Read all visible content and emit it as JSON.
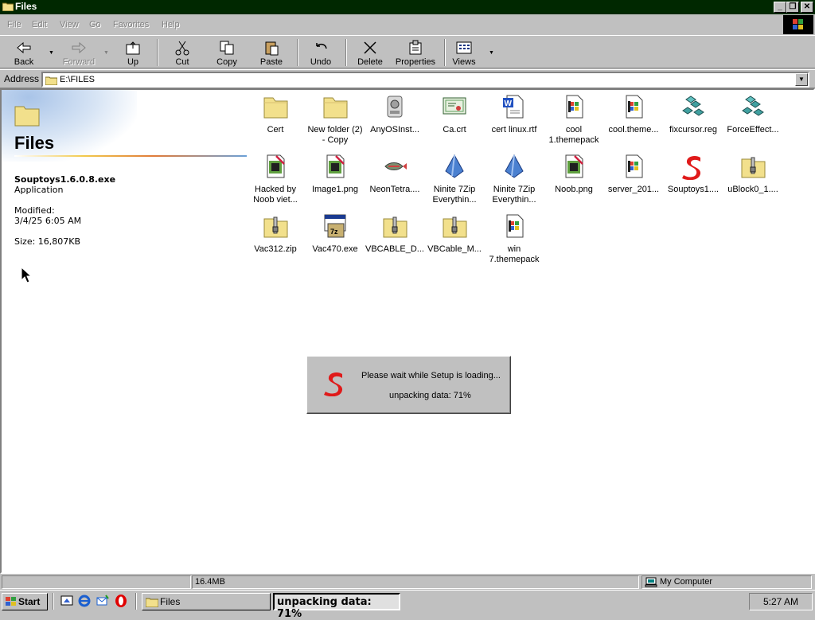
{
  "window": {
    "title": "Files",
    "buttons": [
      "minimize",
      "restore",
      "close"
    ]
  },
  "menu": [
    "File",
    "Edit",
    "View",
    "Go",
    "Favorites",
    "Help"
  ],
  "toolbar": {
    "back": "Back",
    "forward": "Forward",
    "up": "Up",
    "cut": "Cut",
    "copy": "Copy",
    "paste": "Paste",
    "undo": "Undo",
    "delete": "Delete",
    "properties": "Properties",
    "views": "Views"
  },
  "address": {
    "label": "Address",
    "value": "E:\\FILES"
  },
  "webview": {
    "folder_title": "Files",
    "file_name": "Souptoys1.6.0.8.exe",
    "file_type": "Application",
    "modified_label": "Modified:",
    "modified_value": "3/4/25 6:05 AM",
    "size": "Size: 16,807KB"
  },
  "files": [
    {
      "name": "Cert",
      "name2": "",
      "icon": "folder-icon"
    },
    {
      "name": "New folder (2)",
      "name2": "- Copy",
      "icon": "folder-icon"
    },
    {
      "name": "AnyOSInst...",
      "name2": "",
      "icon": "installer-icon"
    },
    {
      "name": "Ca.crt",
      "name2": "",
      "icon": "certificate-icon"
    },
    {
      "name": "cert linux.rtf",
      "name2": "",
      "icon": "word-document-icon"
    },
    {
      "name": "cool",
      "name2": "1.themepack",
      "icon": "themepack-icon"
    },
    {
      "name": "cool.theme...",
      "name2": "",
      "icon": "themepack-icon"
    },
    {
      "name": "fixcursor.reg",
      "name2": "",
      "icon": "registry-icon"
    },
    {
      "name": "ForceEffect...",
      "name2": "",
      "icon": "registry-icon"
    },
    {
      "name": "Hacked by",
      "name2": "Noob viet...",
      "icon": "image-icon"
    },
    {
      "name": "Image1.png",
      "name2": "",
      "icon": "image-icon"
    },
    {
      "name": "NeonTetra....",
      "name2": "",
      "icon": "fish-icon"
    },
    {
      "name": "Ninite 7Zip",
      "name2": "Everythin...",
      "icon": "ninite-icon"
    },
    {
      "name": "Ninite 7Zip",
      "name2": "Everythin...",
      "icon": "ninite-icon"
    },
    {
      "name": "Noob.png",
      "name2": "",
      "icon": "image-icon"
    },
    {
      "name": "server_201...",
      "name2": "",
      "icon": "themepack-icon"
    },
    {
      "name": "Souptoys1....",
      "name2": "",
      "icon": "souptoys-icon"
    },
    {
      "name": "uBlock0_1....",
      "name2": "",
      "icon": "zip-icon"
    },
    {
      "name": "Vac312.zip",
      "name2": "",
      "icon": "zip-icon"
    },
    {
      "name": "Vac470.exe",
      "name2": "",
      "icon": "7zip-installer-icon"
    },
    {
      "name": "VBCABLE_D...",
      "name2": "",
      "icon": "zip-icon"
    },
    {
      "name": "VBCable_M...",
      "name2": "",
      "icon": "zip-icon"
    },
    {
      "name": "win",
      "name2": "7.themepack",
      "icon": "themepack-icon"
    }
  ],
  "setup_dialog": {
    "line1": "Please wait while Setup is loading...",
    "line2": "unpacking data: 71%",
    "progress_percent": 71
  },
  "statusbar": {
    "size": "16.4MB",
    "zone": "My Computer"
  },
  "taskbar": {
    "start": "Start",
    "quicklaunch": [
      "show-desktop-icon",
      "internet-explorer-icon",
      "outlook-express-icon",
      "opera-icon"
    ],
    "tasks": [
      "Files",
      "unpacking data: 71%"
    ],
    "clock": "5:27 AM"
  },
  "colors": {
    "titlebar": "#002800",
    "face": "#c0c0c0",
    "folder": "#f2e08c",
    "souptoys_red": "#e01a1a"
  }
}
